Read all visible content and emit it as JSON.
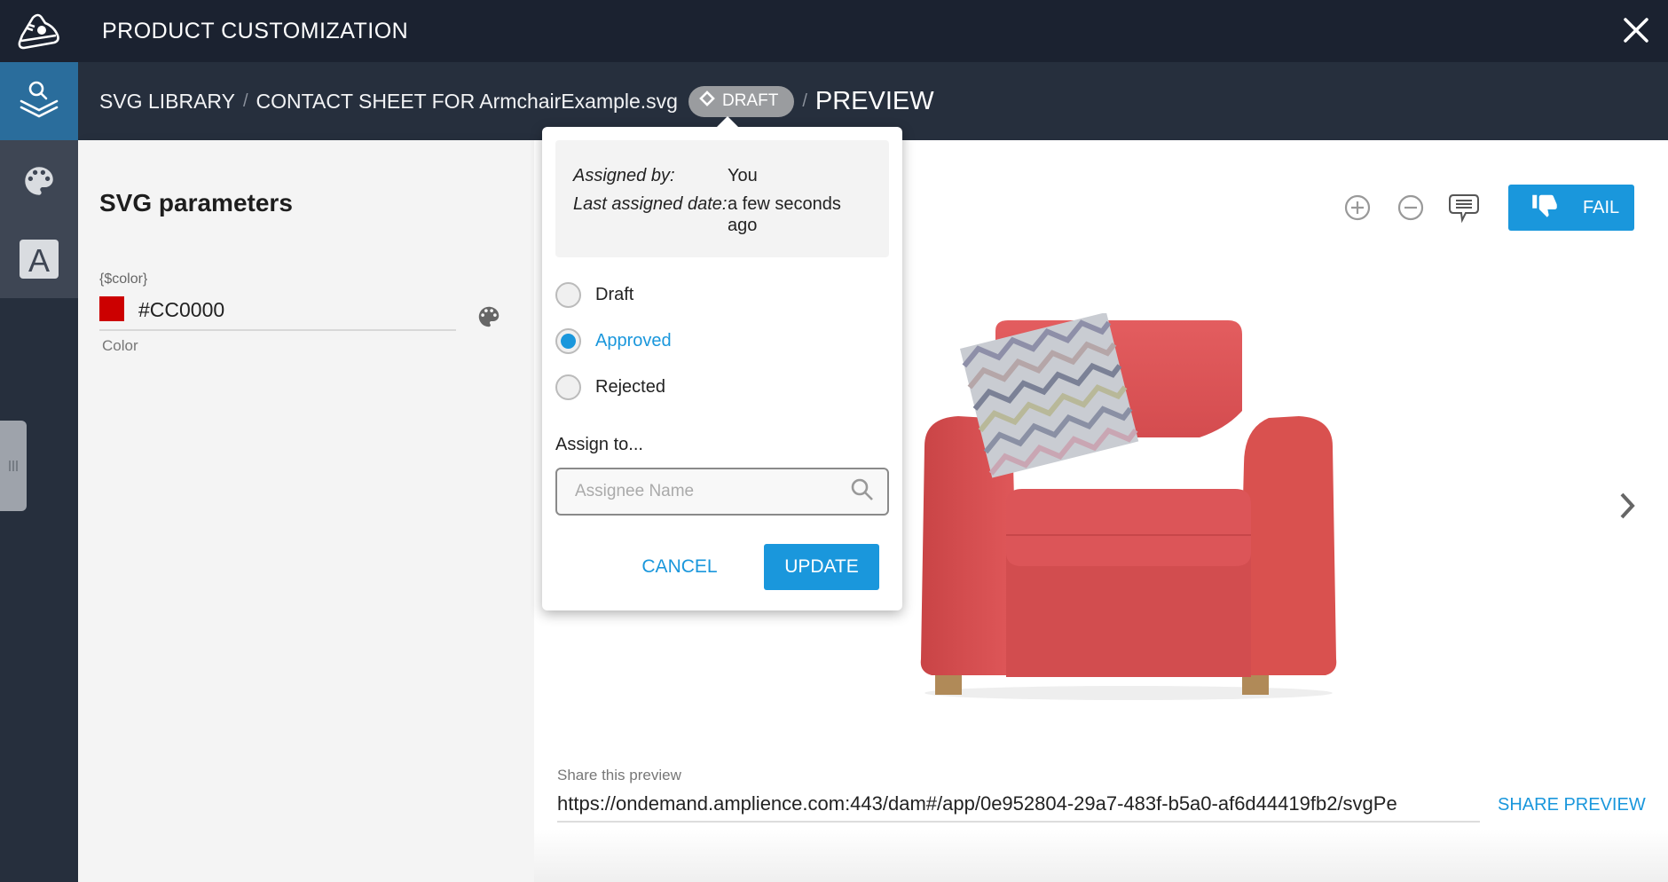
{
  "app": {
    "title": "PRODUCT CUSTOMIZATION",
    "logo_icon": "sneaker-icon",
    "close_icon": "close-icon"
  },
  "sidebar": {
    "items": [
      {
        "name": "svg-library",
        "icon": "layers-search-icon",
        "active": true
      },
      {
        "name": "colors",
        "icon": "palette-icon",
        "active": false
      },
      {
        "name": "text",
        "icon": "text-a-icon",
        "active": false
      }
    ],
    "handle_icon": "drag-handle-icon"
  },
  "breadcrumb": {
    "items": [
      "SVG LIBRARY",
      "CONTACT SHEET FOR ArmchairExample.svg"
    ],
    "separator": "/",
    "status_badge": "DRAFT",
    "current": "PREVIEW"
  },
  "left_panel": {
    "heading": "SVG parameters",
    "params": [
      {
        "key": "{$color}",
        "value": "#CC0000",
        "swatch": "#CC0000",
        "caption": "Color"
      }
    ]
  },
  "toolbar": {
    "zoom_in_icon": "zoom-in-icon",
    "zoom_out_icon": "zoom-out-icon",
    "comment_icon": "comment-icon",
    "fail_label": "FAIL",
    "fail_icon": "thumbs-down-icon"
  },
  "preview": {
    "image_alt": "Red armchair with zigzag cushion",
    "next_icon": "chevron-right-icon"
  },
  "share": {
    "label": "Share this preview",
    "url": "https://ondemand.amplience.com:443/dam#/app/0e952804-29a7-483f-b5a0-af6d44419fb2/svgPe",
    "button": "SHARE PREVIEW"
  },
  "status_popover": {
    "assigned_by_label": "Assigned by:",
    "assigned_by_value": "You",
    "last_assigned_label": "Last assigned date:",
    "last_assigned_value": "a few seconds ago",
    "options": [
      {
        "label": "Draft",
        "selected": false
      },
      {
        "label": "Approved",
        "selected": true
      },
      {
        "label": "Rejected",
        "selected": false
      }
    ],
    "assign_label": "Assign to...",
    "assign_placeholder": "Assignee Name",
    "assign_value": "",
    "cancel": "CANCEL",
    "update": "UPDATE"
  },
  "colors": {
    "accent": "#1A97DC",
    "topbar": "#1B2230",
    "sidebar": "#262F3D",
    "active_nav": "#2A6D9C"
  }
}
